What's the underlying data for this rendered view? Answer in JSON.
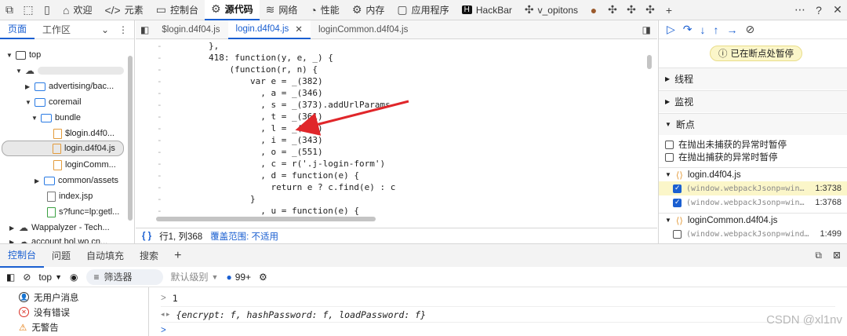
{
  "toolbar": {
    "tabs": [
      {
        "label": "欢迎",
        "icon": "house-icon"
      },
      {
        "label": "元素",
        "icon": "code-icon"
      },
      {
        "label": "控制台",
        "icon": "console-icon"
      },
      {
        "label": "源代码",
        "icon": "sources-icon"
      },
      {
        "label": "网络",
        "icon": "wifi-icon"
      },
      {
        "label": "性能",
        "icon": "performance-icon"
      },
      {
        "label": "内存",
        "icon": "memory-icon"
      },
      {
        "label": "应用程序",
        "icon": "application-icon"
      },
      {
        "label": "HackBar",
        "icon": "hackbar-icon"
      },
      {
        "label": "v_opitons",
        "icon": "puzzle-icon"
      }
    ],
    "active_tab": "源代码"
  },
  "navigator": {
    "tabs": [
      "页面",
      "工作区"
    ],
    "tree": [
      {
        "label": "top"
      },
      {
        "label": "advertising/bac..."
      },
      {
        "label": "coremail"
      },
      {
        "label": "bundle"
      },
      {
        "label": "$login.d4f0..."
      },
      {
        "label": "login.d4f04.js"
      },
      {
        "label": "loginComm..."
      },
      {
        "label": "common/assets"
      },
      {
        "label": "index.jsp"
      },
      {
        "label": "s?func=lp:getl..."
      },
      {
        "label": "Wappalyzer - Tech..."
      },
      {
        "label": "account.bol.wo.cn..."
      }
    ]
  },
  "editor": {
    "tabs": [
      "$login.d4f04.js",
      "login.d4f04.js",
      "loginCommon.d4f04.js"
    ],
    "active_tab": "login.d4f04.js",
    "code": [
      "        },",
      "        418: function(y, e, _) {",
      "            (function(r, n) {",
      "                var e = _(382)",
      "                  , a = _(346)",
      "                  , s = _(373).addUrlParams",
      "                  , t = _(361)",
      "                  , l = _(437)",
      "                  , i = _(343)",
      "                  , o = _(551)",
      "                  , c = r('.j-login-form')",
      "                  , d = function(e) {",
      "                    return e ? c.find(e) : c",
      "                }",
      "                  , u = function(e) {"
    ],
    "status": {
      "brace": "{ }",
      "position": "行1, 列368",
      "coverage": "覆盖范围: 不适用"
    }
  },
  "debugger": {
    "paused_label": "已在断点处暂停",
    "sections": [
      "线程",
      "监视",
      "断点"
    ],
    "options": [
      "在抛出未捕获的异常时暂停",
      "在抛出捕获的异常时暂停"
    ],
    "breakpoint_files": [
      {
        "file": "login.d4f04.js",
        "items": [
          {
            "code": "(window.webpackJsonp=win…",
            "line": "1:3738",
            "checked": true,
            "active": true
          },
          {
            "code": "(window.webpackJsonp=win…",
            "line": "1:3768",
            "checked": true,
            "active": false
          }
        ]
      },
      {
        "file": "loginCommon.d4f04.js",
        "items": [
          {
            "code": "(window.webpackJsonp=wind…",
            "line": "1:499",
            "checked": false,
            "active": false
          }
        ]
      }
    ]
  },
  "drawer": {
    "tabs": [
      "控制台",
      "问题",
      "自动填充",
      "搜索"
    ],
    "context": "top",
    "filter_placeholder": "筛选器",
    "level": "默认级别",
    "issues_count": "99+"
  },
  "console": {
    "sidebar": [
      "无用户消息",
      "没有错误",
      "无警告"
    ],
    "lines": [
      {
        "prefix": ">",
        "text": "1"
      },
      {
        "prefix": "◂ ▸",
        "text": "{encrypt: f, hashPassword: f, loadPassword: f}"
      },
      {
        "prefix": ">",
        "text": ""
      }
    ]
  },
  "watermark": "CSDN @xl1nv",
  "colors": {
    "accent": "#1a5fd1",
    "paused_bg": "#fbf6c9",
    "arrow": "#e0262a"
  }
}
